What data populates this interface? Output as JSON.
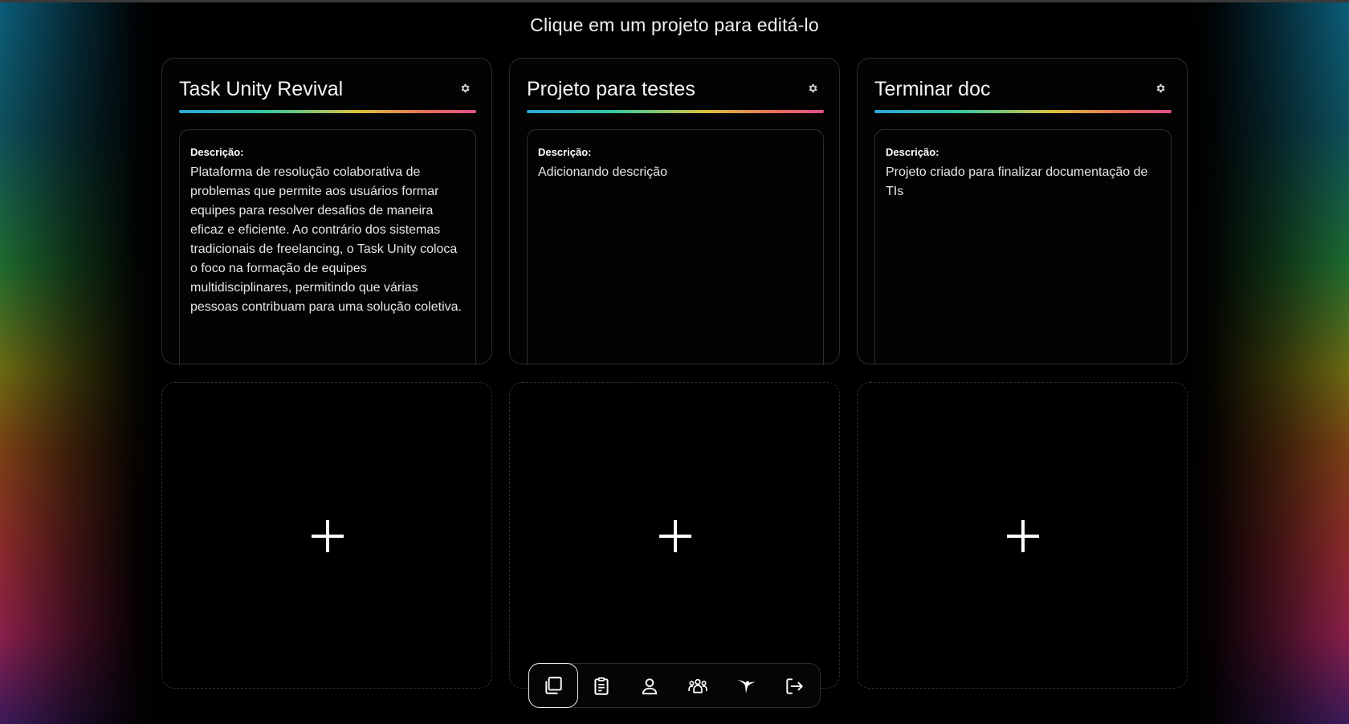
{
  "header": {
    "instruction": "Clique em um projeto para editá-lo"
  },
  "projects": [
    {
      "title": "Task Unity Revival",
      "description_label": "Descrição:",
      "description": "Plataforma de resolução colaborativa de problemas que permite aos usuários formar equipes para resolver desafios de maneira eficaz e eficiente. Ao contrário dos sistemas tradicionais de freelancing, o Task Unity coloca o foco na formação de equipes multidisciplinares, permitindo que várias pessoas contribuam para uma solução coletiva."
    },
    {
      "title": "Projeto para testes",
      "description_label": "Descrição:",
      "description": "Adicionando descrição"
    },
    {
      "title": "Terminar doc",
      "description_label": "Descrição:",
      "description": "Projeto criado para finalizar documentação de TIs"
    }
  ],
  "add_slots": 3,
  "dock": {
    "items": [
      {
        "icon": "projects-icon",
        "active": true
      },
      {
        "icon": "clipboard-icon",
        "active": false
      },
      {
        "icon": "user-icon",
        "active": false
      },
      {
        "icon": "team-icon",
        "active": false
      },
      {
        "icon": "hummingbird-icon",
        "active": false
      },
      {
        "icon": "logout-icon",
        "active": false
      }
    ]
  },
  "colors": {
    "background": "#000000",
    "card_border": "#2b2b2b",
    "title_gradient": [
      "#2aa7d8",
      "#3ac9a0",
      "#d9c23a",
      "#e96a5b",
      "#e2508c"
    ]
  }
}
